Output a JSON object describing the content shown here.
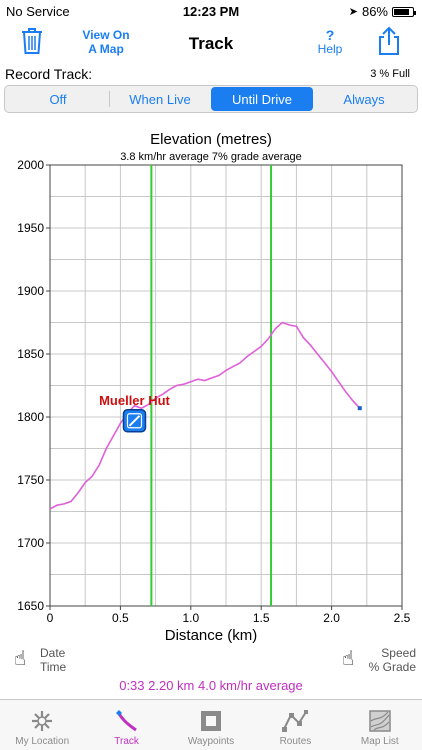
{
  "status_bar": {
    "carrier": "No Service",
    "time": "12:23 PM",
    "battery": "86%",
    "battery_level": 0.86
  },
  "nav": {
    "view_map_line1": "View On",
    "view_map_line2": "A Map",
    "title": "Track",
    "help_symbol": "?",
    "help_label": "Help"
  },
  "record": {
    "label": "Record Track:",
    "full": "3 % Full",
    "options": [
      "Off",
      "When Live",
      "Until Drive",
      "Always"
    ],
    "selected": "Until Drive"
  },
  "chart_data": {
    "type": "line",
    "title": "Elevation (metres)",
    "subtitle": "3.8 km/hr average  7% grade average",
    "xlabel": "Distance (km)",
    "ylabel": "",
    "xlim": [
      0,
      2.5
    ],
    "ylim": [
      1650,
      2000
    ],
    "x_ticks": [
      "0",
      "0.5",
      "1.0",
      "1.5",
      "2.0",
      "2.5"
    ],
    "y_ticks": [
      "2000",
      "1950",
      "1900",
      "1850",
      "1800",
      "1750",
      "1700",
      "1650"
    ],
    "grid": true,
    "series": [
      {
        "color": "#e060d8",
        "x": [
          0,
          0.05,
          0.1,
          0.15,
          0.2,
          0.25,
          0.3,
          0.35,
          0.4,
          0.45,
          0.5,
          0.55,
          0.6,
          0.65,
          0.7,
          0.75,
          0.8,
          0.85,
          0.9,
          0.95,
          1.0,
          1.05,
          1.1,
          1.15,
          1.2,
          1.25,
          1.3,
          1.35,
          1.4,
          1.45,
          1.5,
          1.55,
          1.6,
          1.65,
          1.7,
          1.75,
          1.8,
          1.85,
          1.9,
          1.95,
          2.0,
          2.05,
          2.1,
          2.15,
          2.2
        ],
        "y": [
          1727,
          1730,
          1731,
          1733,
          1740,
          1748,
          1753,
          1762,
          1775,
          1785,
          1795,
          1803,
          1809,
          1807,
          1810,
          1815,
          1818,
          1822,
          1825,
          1826,
          1828,
          1830,
          1829,
          1831,
          1833,
          1837,
          1840,
          1843,
          1848,
          1852,
          1856,
          1862,
          1870,
          1875,
          1873,
          1872,
          1863,
          1857,
          1850,
          1843,
          1836,
          1828,
          1820,
          1813,
          1807
        ]
      }
    ],
    "vertical_markers": [
      0.72,
      1.57
    ],
    "marker_color": "#33cc33",
    "annotation": "Mueller Hut",
    "annotation_color": "#cc1010"
  },
  "footer": {
    "left_line1": "Date",
    "left_line2": "Time",
    "right_line1": "Speed",
    "right_line2": "% Grade",
    "summary": "0:33   2.20 km   4.0 km/hr average"
  },
  "tabs": [
    {
      "label": "My Location",
      "icon": "gear-icon"
    },
    {
      "label": "Track",
      "icon": "track-icon"
    },
    {
      "label": "Waypoints",
      "icon": "square-icon"
    },
    {
      "label": "Routes",
      "icon": "route-icon"
    },
    {
      "label": "Map List",
      "icon": "map-icon"
    }
  ],
  "colors": {
    "accent": "#1a7ef0",
    "track": "#c030c0"
  }
}
